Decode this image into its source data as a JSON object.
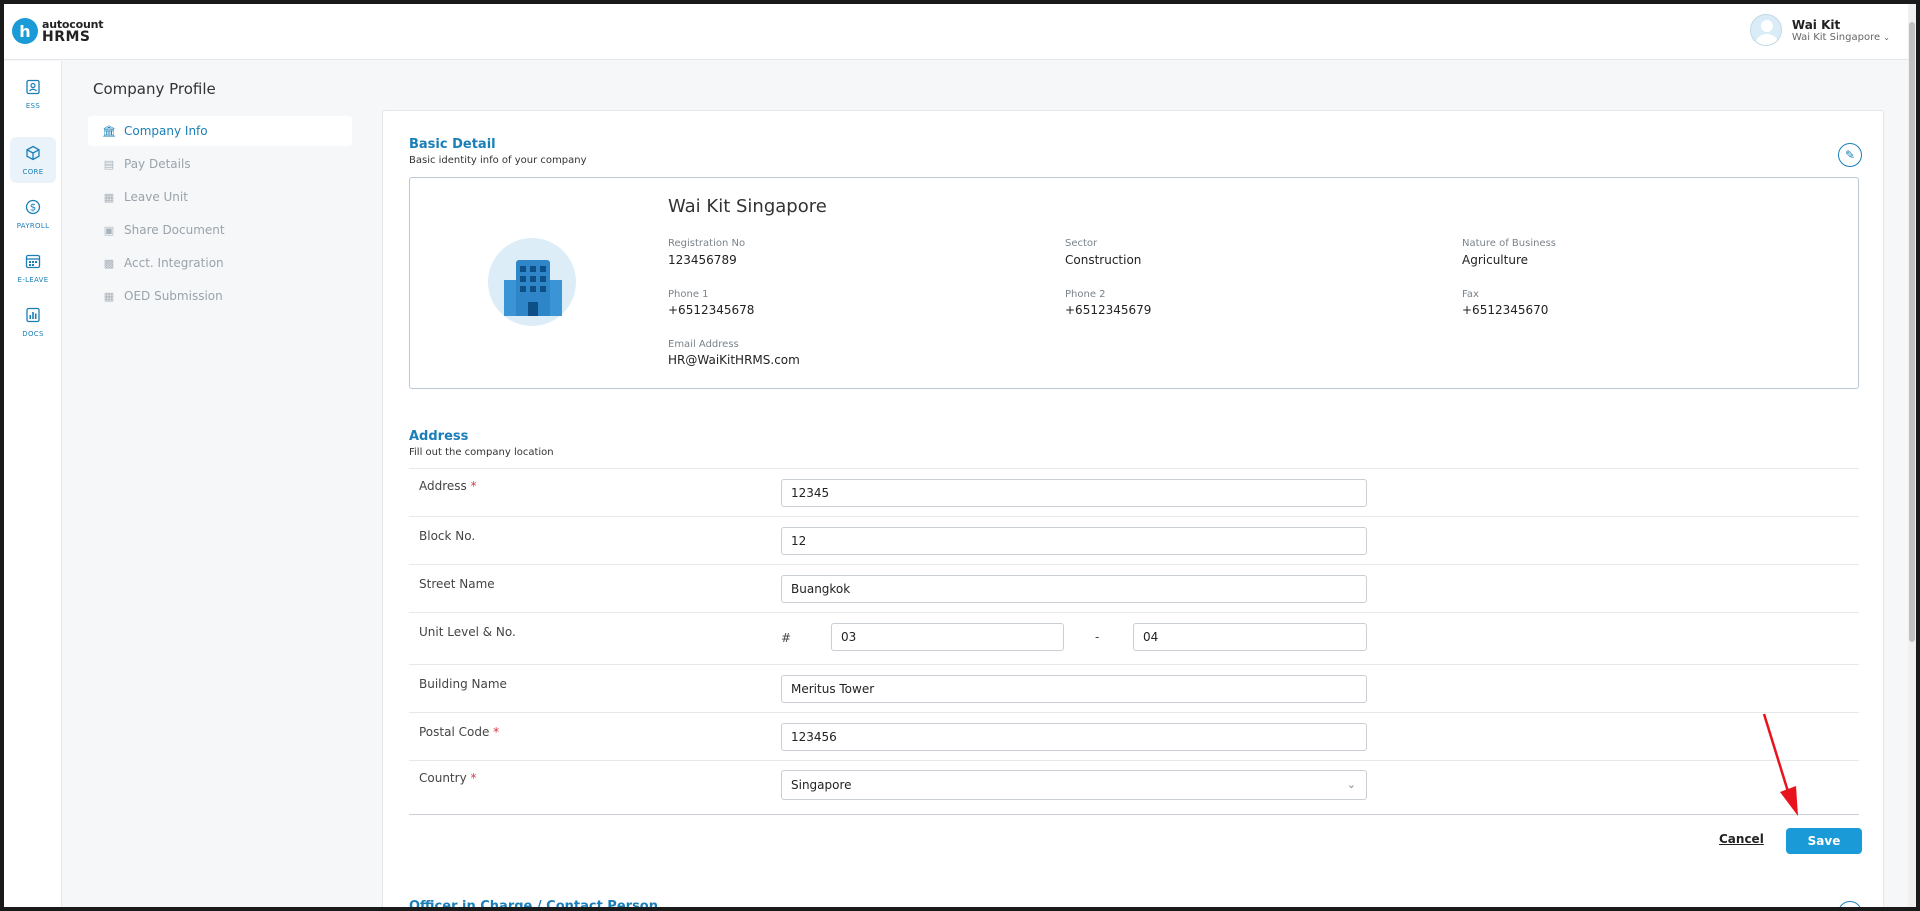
{
  "app": {
    "logo_letter": "h",
    "logo_small": "autocount",
    "logo_big": "HRMS"
  },
  "user": {
    "name": "Wai Kit",
    "company": "Wai Kit Singapore"
  },
  "rail": [
    {
      "label": "ESS",
      "icon": "id-card-icon"
    },
    {
      "label": "CORE",
      "icon": "cube-icon"
    },
    {
      "label": "PAYROLL",
      "icon": "dollar-icon"
    },
    {
      "label": "E-LEAVE",
      "icon": "calendar-icon"
    },
    {
      "label": "DOCS",
      "icon": "docs-chart-icon"
    }
  ],
  "page": {
    "title": "Company Profile"
  },
  "subnav": [
    {
      "label": "Company Info",
      "icon": "bank-icon"
    },
    {
      "label": "Pay Details",
      "icon": "document-icon"
    },
    {
      "label": "Leave Unit",
      "icon": "calendar-icon"
    },
    {
      "label": "Share Document",
      "icon": "share-doc-icon"
    },
    {
      "label": "Acct. Integration",
      "icon": "integration-icon"
    },
    {
      "label": "OED Submission",
      "icon": "submission-icon"
    }
  ],
  "basic": {
    "title": "Basic Detail",
    "subtitle": "Basic identity info of your company",
    "company_name": "Wai Kit Singapore",
    "fields": {
      "registration_label": "Registration No",
      "registration_value": "123456789",
      "sector_label": "Sector",
      "sector_value": "Construction",
      "nature_label": "Nature of Business",
      "nature_value": "Agriculture",
      "phone1_label": "Phone 1",
      "phone1_value": "+6512345678",
      "phone2_label": "Phone 2",
      "phone2_value": "+6512345679",
      "fax_label": "Fax",
      "fax_value": "+6512345670",
      "email_label": "Email Address",
      "email_value": "HR@WaiKitHRMS.com"
    }
  },
  "address": {
    "title": "Address",
    "subtitle": "Fill out the company location",
    "address_label": "Address",
    "address_value": "12345",
    "block_label": "Block No.",
    "block_value": "12",
    "street_label": "Street Name",
    "street_value": "Buangkok",
    "unit_label": "Unit Level & No.",
    "unit_hash": "#",
    "unit_level": "03",
    "unit_dash": "-",
    "unit_no": "04",
    "building_label": "Building Name",
    "building_value": "Meritus Tower",
    "postal_label": "Postal Code",
    "postal_value": "123456",
    "country_label": "Country",
    "country_value": "Singapore",
    "required_mark": "*"
  },
  "actions": {
    "cancel": "Cancel",
    "save": "Save"
  },
  "officer": {
    "title": "Officer in Charge / Contact Person"
  },
  "colors": {
    "accent": "#1a7fb8",
    "primary_button": "#1a9ad6",
    "annotation_arrow": "#e8131c"
  }
}
